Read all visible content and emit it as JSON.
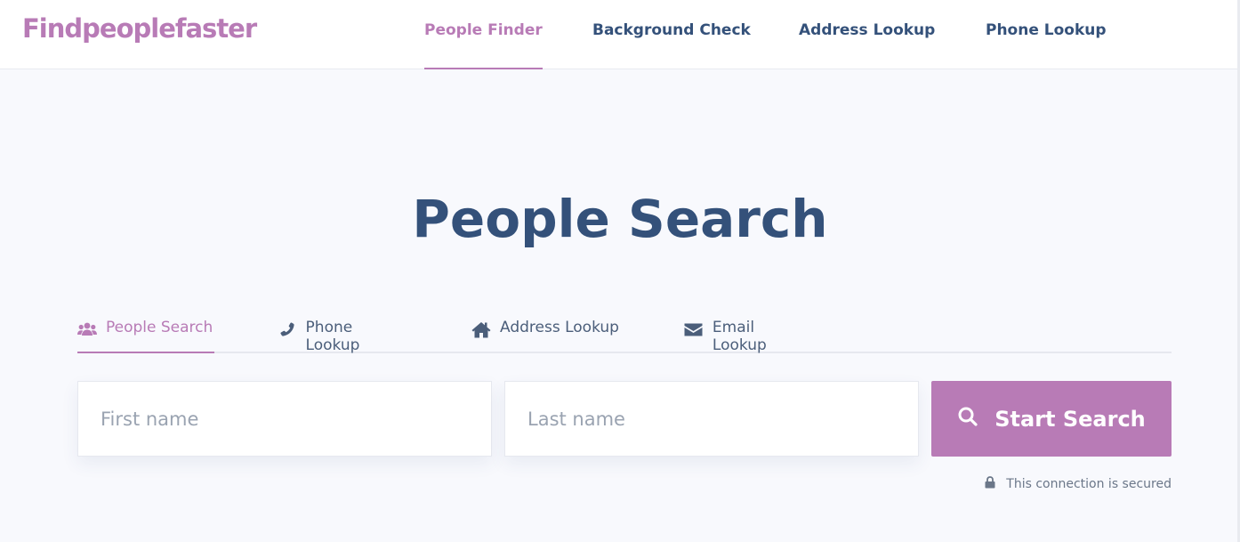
{
  "header": {
    "logo": "Findpeoplefaster",
    "nav": [
      {
        "label": "People Finder",
        "active": true
      },
      {
        "label": "Background Check",
        "active": false
      },
      {
        "label": "Address Lookup",
        "active": false
      },
      {
        "label": "Phone Lookup",
        "active": false
      }
    ]
  },
  "main": {
    "title": "People Search",
    "tabs": [
      {
        "label": "People Search",
        "icon": "users-icon",
        "active": true
      },
      {
        "label": "Phone Lookup",
        "icon": "phone-icon",
        "active": false
      },
      {
        "label": "Address Lookup",
        "icon": "home-icon",
        "active": false
      },
      {
        "label": "Email Lookup",
        "icon": "envelope-icon",
        "active": false
      }
    ],
    "form": {
      "first_name": {
        "value": "",
        "placeholder": "First name"
      },
      "last_name": {
        "value": "",
        "placeholder": "Last name"
      },
      "submit_label": "Start Search",
      "submit_icon": "search-icon"
    },
    "secure_text": "This connection is secured",
    "secure_icon": "lock-icon"
  },
  "colors": {
    "accent": "#b87bb6",
    "heading": "#34517a",
    "background": "#f8f9fd"
  }
}
